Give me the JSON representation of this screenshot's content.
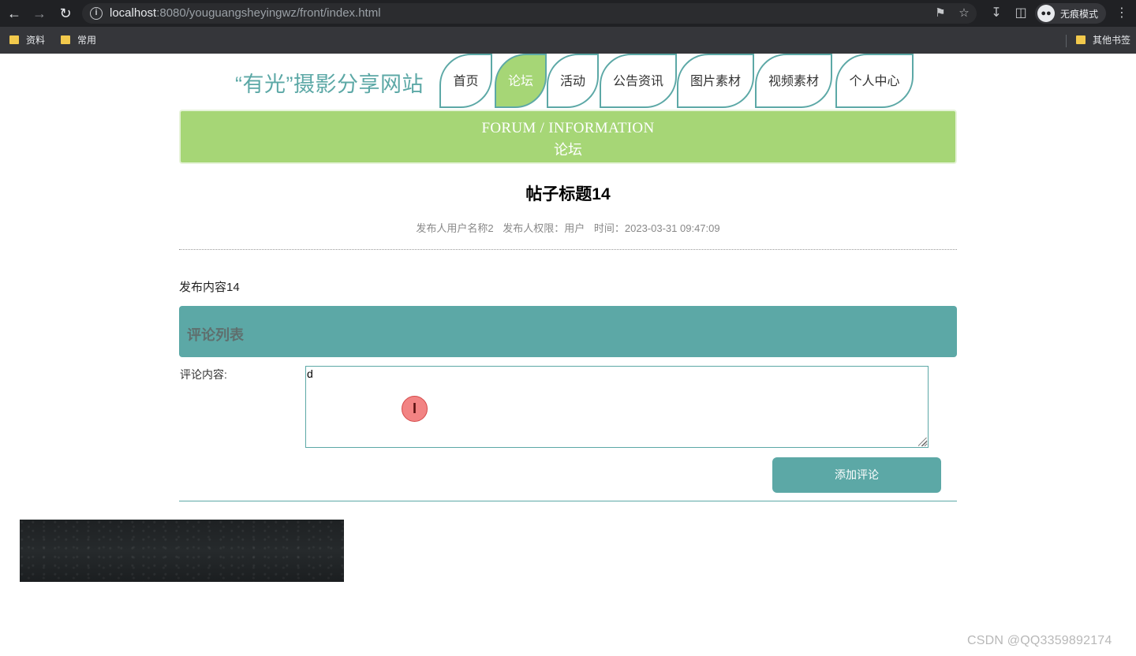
{
  "browser": {
    "url_host": "localhost",
    "url_rest": ":8080/youguangsheyingwz/front/index.html",
    "incognito_label": "无痕模式",
    "bookmarks": [
      "资料",
      "常用"
    ],
    "other_bookmarks": "其他书签"
  },
  "site": {
    "title": "“有光”摄影分享网站",
    "nav": [
      {
        "label": "首页",
        "active": false
      },
      {
        "label": "论坛",
        "active": true
      },
      {
        "label": "活动",
        "active": false
      },
      {
        "label": "公告资讯",
        "active": false
      },
      {
        "label": "图片素材",
        "active": false
      },
      {
        "label": "视频素材",
        "active": false
      },
      {
        "label": "个人中心",
        "active": false
      }
    ]
  },
  "banner": {
    "en": "FORUM / INFORMATION",
    "cn": "论坛"
  },
  "post": {
    "title": "帖子标题14",
    "author": "发布人用户名称2",
    "role": "发布人权限：用户",
    "time": "时间：2023-03-31 09:47:09",
    "content": "发布内容14"
  },
  "comments": {
    "header": "评论列表",
    "label": "评论内容:",
    "input_value": "d",
    "submit_label": "添加评论"
  },
  "watermark": "CSDN @QQ3359892174",
  "colors": {
    "teal": "#5ca8a6",
    "green": "#a6d676"
  }
}
